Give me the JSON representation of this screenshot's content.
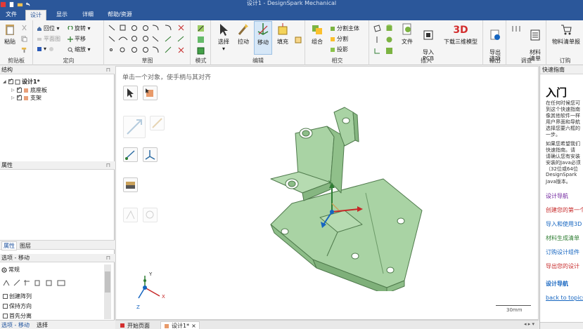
{
  "window": {
    "title": "设计1 - DesignSpark Mechanical"
  },
  "tabs": [
    {
      "label": "文件",
      "active": false
    },
    {
      "label": "设计",
      "active": true
    },
    {
      "label": "显示",
      "active": false
    },
    {
      "label": "详细",
      "active": false
    },
    {
      "label": "帮助/资源",
      "active": false
    }
  ],
  "ribbon": {
    "clipboard": {
      "label": "剪贴板",
      "paste": "粘贴"
    },
    "orient": {
      "label": "定向",
      "home": "回位",
      "plane_view": "平面图",
      "rotate": "旋转",
      "pan": "平移",
      "zoom": "缩放"
    },
    "sketch": {
      "label": "草图"
    },
    "mode": {
      "label": "模式"
    },
    "edit": {
      "label": "编辑",
      "select": "选择",
      "pull": "拉动",
      "move": "移动",
      "fill": "填充"
    },
    "intersect": {
      "label": "相交",
      "combine": "组合",
      "split_body": "分割主体",
      "split": "分割",
      "project": "投影"
    },
    "insert": {
      "label": "插入",
      "file": "文件",
      "import_pcb": "导入\nPCB",
      "download_3d": "下载三维模型",
      "logo_3d": "3D"
    },
    "output": {
      "label": "输出",
      "export_options": "导出\n选项"
    },
    "investigate": {
      "label": "调查",
      "bom": "材料\n清单"
    },
    "order": {
      "label": "订购",
      "bom_order": "物料清单报"
    }
  },
  "structure": {
    "title": "结构",
    "root": "设计1*",
    "children": [
      "底座板",
      "支架"
    ]
  },
  "properties": {
    "title": "属性"
  },
  "panel_tabs": [
    "属性",
    "图层"
  ],
  "options": {
    "title": "选项 - 移动",
    "section": "常规",
    "items": [
      "创建阵列",
      "保持方向",
      "首先分离"
    ]
  },
  "status": {
    "left": "选项 - 移动",
    "right": "选择"
  },
  "viewport": {
    "hint": "单击一个对象，使手柄与其对齐",
    "scale": "30mm",
    "axes": {
      "x": "X",
      "y": "Y",
      "z": "Z"
    }
  },
  "doc_tabs": [
    {
      "label": "开始页面"
    },
    {
      "label": "设计1*"
    }
  ],
  "guide": {
    "title": "快速指南",
    "heading": "入门",
    "paragraph1": [
      "在任何时候您可",
      "到这个快速指南",
      "像其他软件一样",
      "用户界面和导航",
      "选择您要六框的",
      "一步。"
    ],
    "paragraph2": [
      "如果您希望我们",
      "快速指南。请",
      "请确认您有安装",
      "安装的Java必须",
      "（32位或64位",
      "DesignSpark",
      "Java版本。"
    ],
    "links": [
      "设计导航",
      "创建您的第一个",
      "导入和使用3D",
      "材料生成清单",
      "订购设计组件",
      "导出您的设计",
      "设计导航",
      "back to topics"
    ],
    "link_colors": [
      "#6a1b9a",
      "#c62828",
      "#1565c0",
      "#2e7d32",
      "#1565c0",
      "#c62828",
      "#1565c0",
      "#1565c0"
    ]
  },
  "colors": {
    "model": "#a9d3a4",
    "model_edge": "#4f7a4c",
    "titlebar": "#2b579a"
  }
}
